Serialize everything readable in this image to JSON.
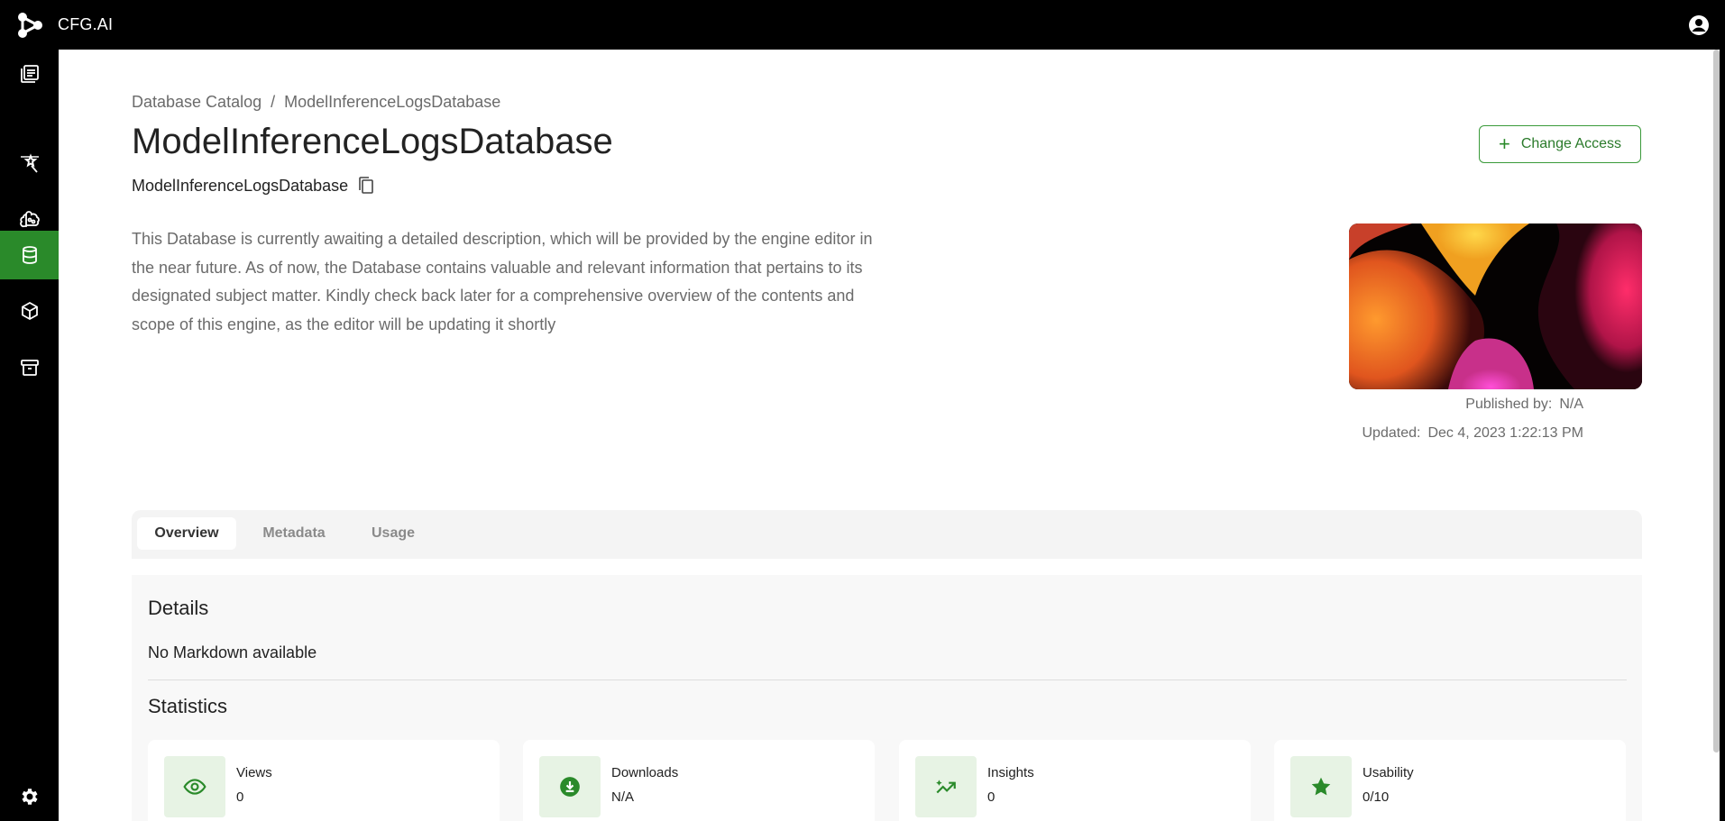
{
  "app": {
    "name": "CFG.AI"
  },
  "sidebar": {
    "items": [
      {
        "icon": "library-icon"
      },
      {
        "icon": "prompt-icon"
      },
      {
        "icon": "brain-icon"
      },
      {
        "icon": "database-icon",
        "active": true
      },
      {
        "icon": "model-cube-icon"
      },
      {
        "icon": "archive-icon"
      }
    ],
    "settings_icon": "gear-icon"
  },
  "breadcrumb": {
    "root": "Database Catalog",
    "separator": "/",
    "current": "ModelInferenceLogsDatabase"
  },
  "page": {
    "title": "ModelInferenceLogsDatabase",
    "id": "ModelInferenceLogsDatabase",
    "description": "This Database is currently awaiting a detailed description, which will be provided by the engine editor in the near future. As of now, the Database contains valuable and relevant information that pertains to its designated subject matter. Kindly check back later for a comprehensive overview of the contents and scope of this engine, as the editor will be updating it shortly",
    "change_access_label": "Change Access",
    "published_label": "Published by:",
    "published_value": "N/A",
    "updated_label": "Updated:",
    "updated_value": "Dec 4, 2023 1:22:13 PM"
  },
  "tabs": [
    {
      "label": "Overview",
      "active": true
    },
    {
      "label": "Metadata"
    },
    {
      "label": "Usage"
    }
  ],
  "details": {
    "heading": "Details",
    "body": "No Markdown available"
  },
  "statistics": {
    "heading": "Statistics",
    "cards": [
      {
        "label": "Views",
        "value": "0",
        "icon": "eye-icon"
      },
      {
        "label": "Downloads",
        "value": "N/A",
        "icon": "download-icon"
      },
      {
        "label": "Insights",
        "value": "0",
        "icon": "insights-icon"
      },
      {
        "label": "Usability",
        "value": "0/10",
        "icon": "star-icon"
      }
    ]
  },
  "colors": {
    "accent": "#2a8a2a",
    "accent_light": "#e7f3e4",
    "topbar": "#000000"
  }
}
